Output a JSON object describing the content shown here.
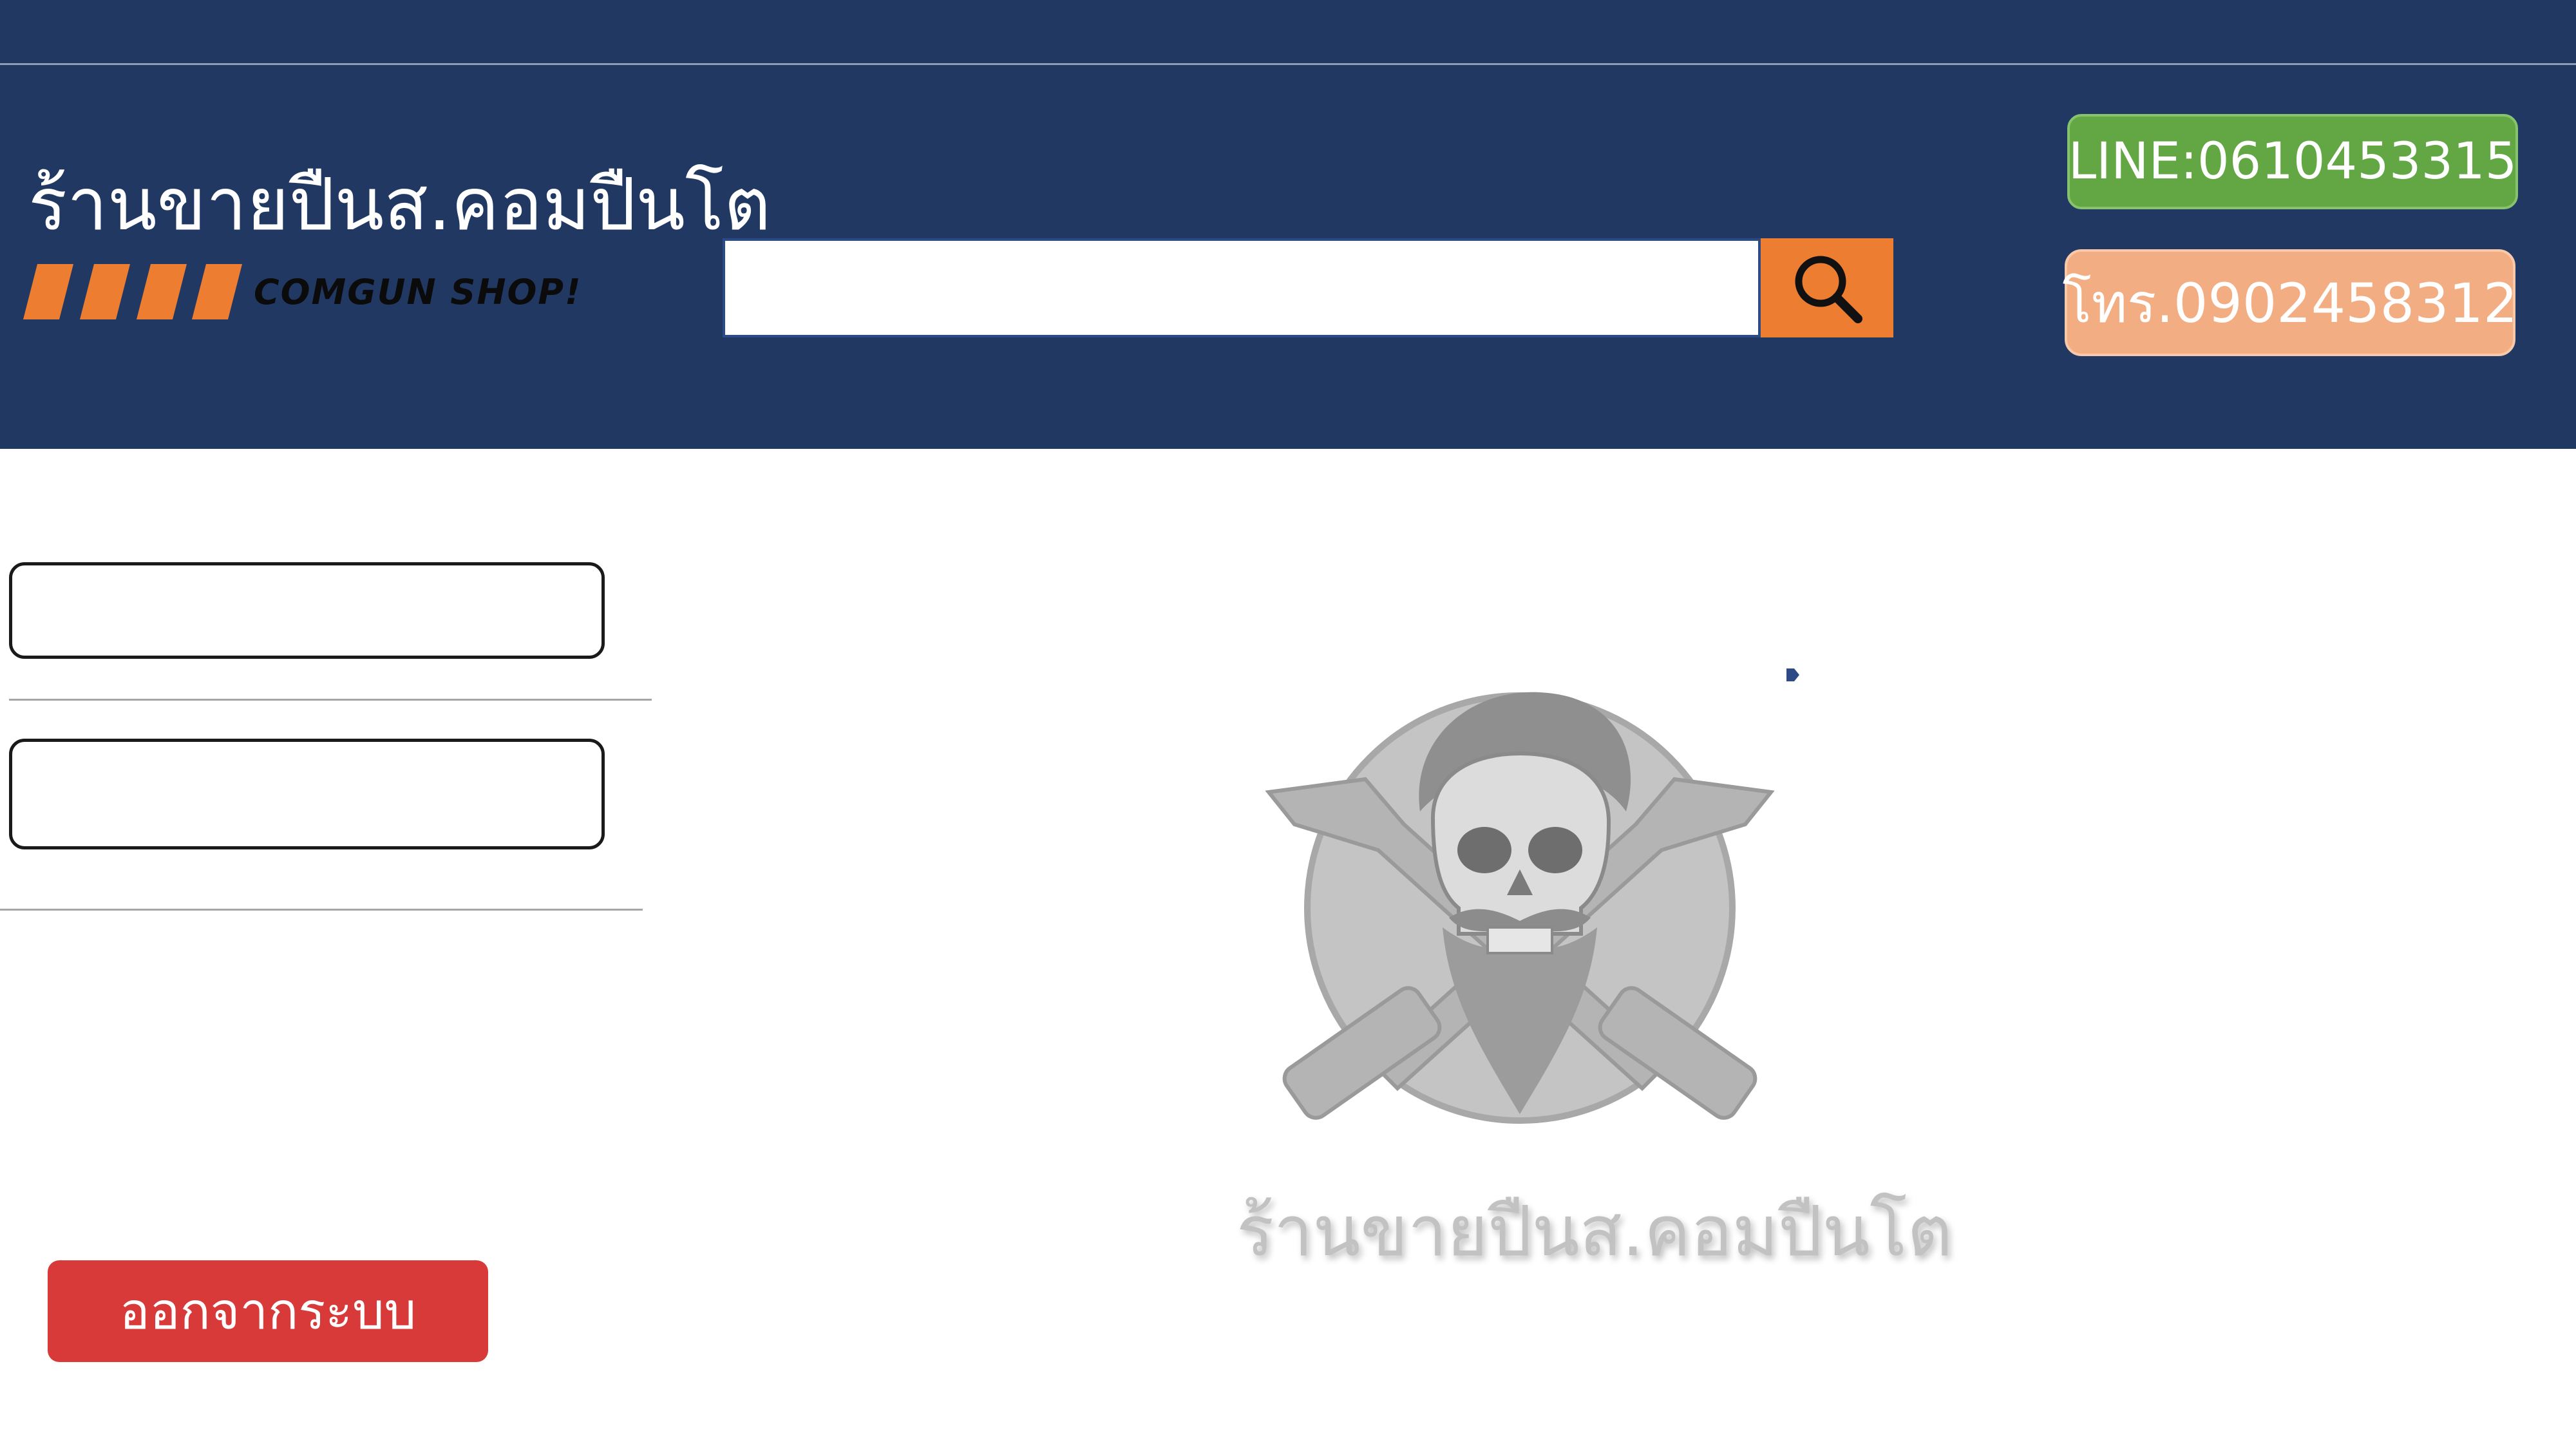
{
  "header": {
    "brand_title": "ร้านขายปืนส.คอมปืนโต",
    "brand_subtitle": "COMGUN SHOP!",
    "search": {
      "value": "",
      "placeholder": ""
    },
    "line_button_label": "LINE:0610453315",
    "tel_button_label": "โทร.0902458312"
  },
  "sidebar": {
    "field1": {
      "value": ""
    },
    "field2": {
      "value": ""
    },
    "logout_label": "ออกจากระบบ"
  },
  "main": {
    "watermark_text": "ร้านขายปืนส.คอมปืนโต"
  },
  "icons": {
    "search": "magnifier-icon",
    "brand": "stripe-icon",
    "emblem": "bearded-skull-crossed-guns-logo",
    "marker": "arrow-right-icon"
  },
  "colors": {
    "header_bg": "#213863",
    "accent_orange": "#ed7d31",
    "line_green": "#62a744",
    "tel_peach": "#f3ad82",
    "logout_red": "#d83a3a"
  }
}
